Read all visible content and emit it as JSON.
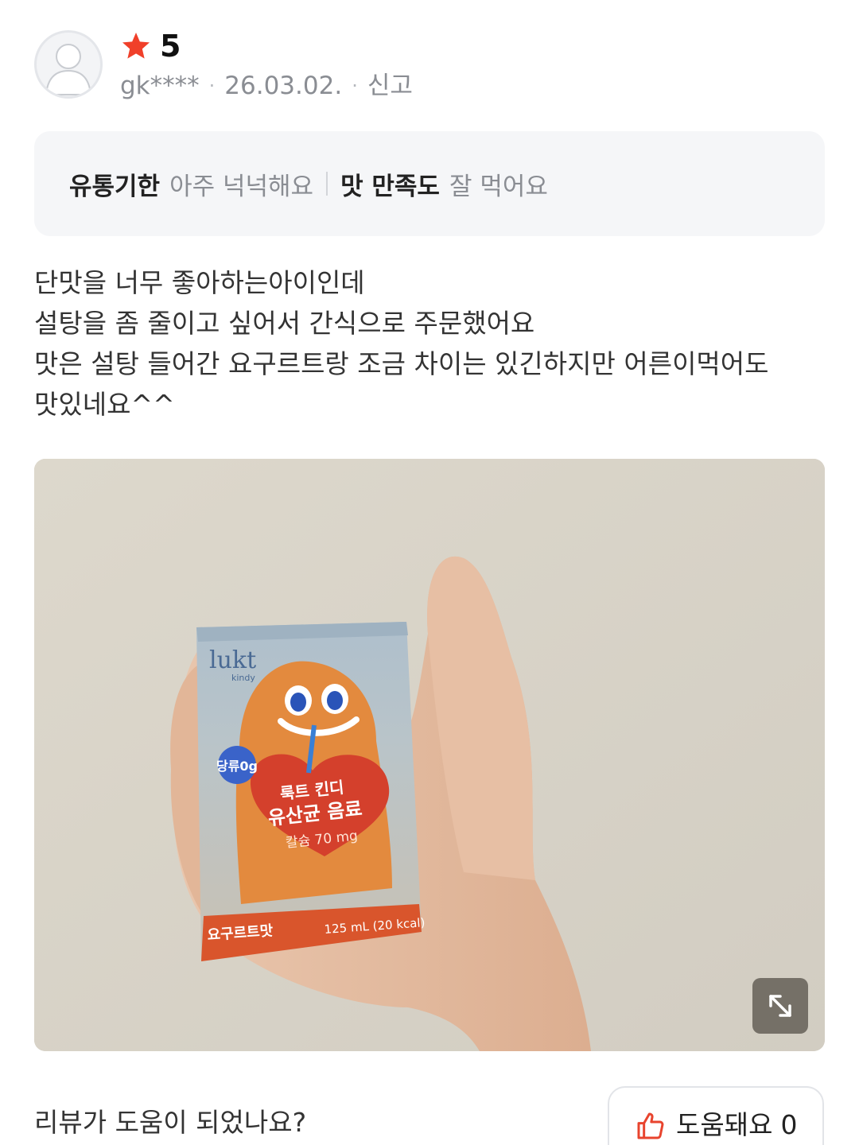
{
  "review": {
    "rating": "5",
    "reviewer": "gk****",
    "date": "26.03.02.",
    "report_label": "신고",
    "tags": [
      {
        "key": "유통기한",
        "value": "아주 넉넉해요"
      },
      {
        "key": "맛 만족도",
        "value": "잘 먹어요"
      }
    ],
    "text_lines": [
      "단맛을 너무 좋아하는아이인데",
      "설탕을 좀 줄이고 싶어서 간식으로 주문했어요",
      "맛은 설탕 들어간 요구르트랑 조금 차이는 있긴하지만 어른이먹어도",
      "맛있네요^^"
    ],
    "photo": {
      "brand": "lukt",
      "brand_sub": "kindy",
      "sugar_badge": "당류0g",
      "product_name_1": "룩트 킨디",
      "product_name_2": "유산균 음료",
      "calcium": "칼슘 70 mg",
      "flavor": "요구르트맛",
      "volume": "125 mL (20 kcal)"
    }
  },
  "footer": {
    "question": "리뷰가 도움이 되었나요?",
    "helpful_label": "도움돼요",
    "helpful_count": "0"
  },
  "colors": {
    "star": "#f0402a",
    "meta": "#8a8d93",
    "tags_bg": "#f5f6f8",
    "thumb": "#e8442e"
  },
  "icons": {
    "rating": "star-icon",
    "avatar": "user-silhouette-icon",
    "expand": "expand-diagonal-icon",
    "helpful": "thumbs-up-icon"
  }
}
